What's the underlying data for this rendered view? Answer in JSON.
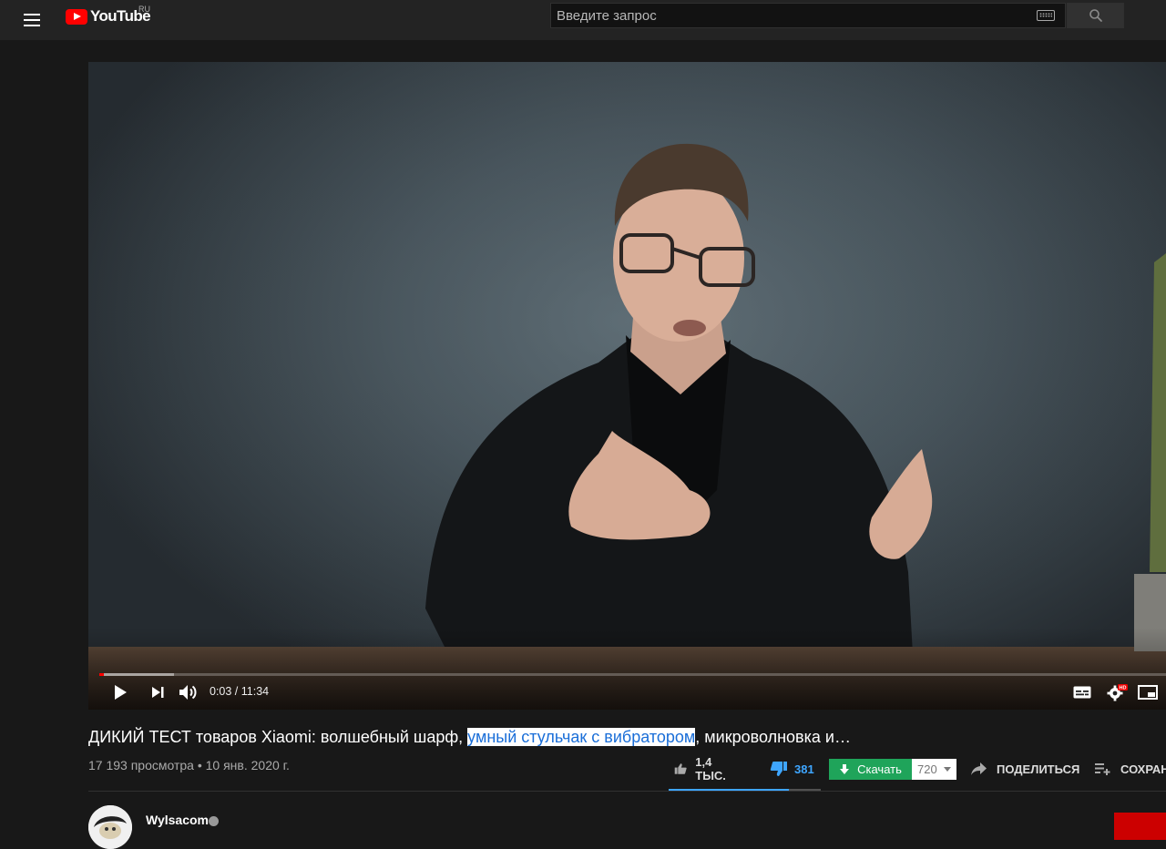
{
  "masthead": {
    "logo_text": "YouTube",
    "country_code": "RU",
    "search_placeholder": "Введите запрос"
  },
  "player": {
    "current_time": "0:03",
    "duration": "11:34",
    "time_text": "0:03 / 11:34",
    "progress_played": 0.004,
    "progress_buffered": 0.07,
    "hd_badge": "HD"
  },
  "video": {
    "title_before": "ДИКИЙ ТЕСТ товаров Xiaomi: волшебный шарф, ",
    "title_highlight": "умный стульчак с вибратором",
    "title_after": ", микроволновка и…",
    "views": "17 193 просмотра",
    "separator": "•",
    "date": "10 янв. 2020 г.",
    "views_date": "17 193 просмотра • 10 янв. 2020 г."
  },
  "actions": {
    "likes": "1,4 ТЫС.",
    "dislikes": "381",
    "like_ratio": 0.79,
    "download_label": "Скачать",
    "quality": "720",
    "share_label": "ПОДЕЛИТЬСЯ",
    "save_label": "СОХРАН"
  },
  "channel": {
    "name": "Wylsacom"
  },
  "colors": {
    "background": "#181818",
    "masthead": "#232323",
    "accent_red": "#ff0000",
    "dislike_blue": "#3ea6ff",
    "download_green": "#1fa45a",
    "highlight_text": "#1a6ed8"
  }
}
